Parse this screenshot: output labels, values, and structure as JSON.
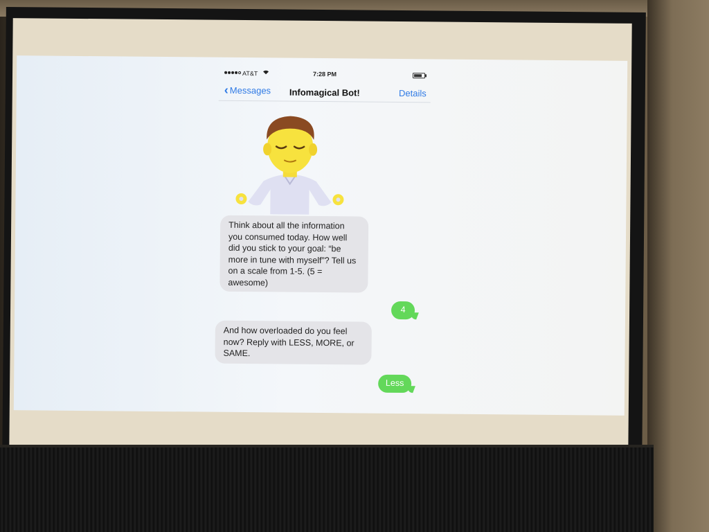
{
  "status_bar": {
    "carrier": "AT&T",
    "time": "7:28 PM",
    "signal_icon": "signal-dots-icon",
    "wifi_icon": "wifi-icon",
    "battery_icon": "battery-icon"
  },
  "nav": {
    "back_label": "Messages",
    "title": "Infomagical Bot!",
    "details_label": "Details"
  },
  "emoji": "person-meditating-emoji",
  "messages": [
    {
      "direction": "incoming",
      "text": "Think about all the information you consumed today. How well did you stick to your goal: “be more in tune with myself”? Tell us on a scale from 1-5. (5 = awesome)"
    },
    {
      "direction": "outgoing",
      "text": "4"
    },
    {
      "direction": "incoming",
      "text": "And how overloaded do you feel now? Reply with LESS, MORE, or SAME."
    },
    {
      "direction": "outgoing",
      "text": "Less"
    }
  ],
  "colors": {
    "ios_blue": "#2f7ae5",
    "incoming_bubble": "#e4e4e8",
    "outgoing_bubble": "#63d85a"
  }
}
